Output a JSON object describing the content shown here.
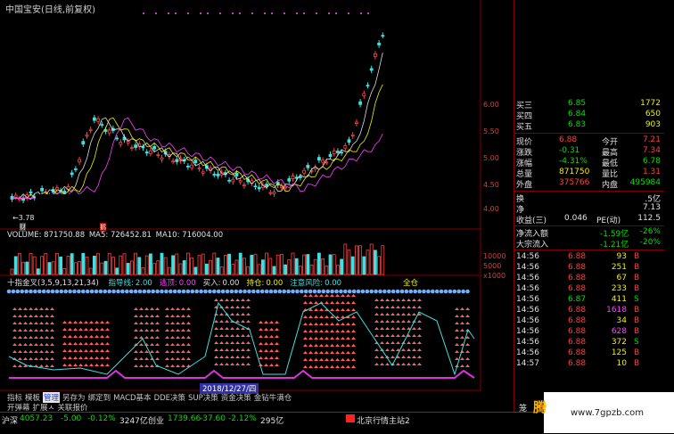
{
  "title": "中国宝安(日线,前复权)",
  "y_labels": [
    "6.00",
    "5.50",
    "5.00",
    "4.50",
    "4.00",
    "10000",
    "5000",
    "x1000"
  ],
  "min_label": "3.78",
  "cai_label": "财",
  "hui_label": "鹅",
  "volume": {
    "label": "VOLUME: 871750.88",
    "ma5": "MA5: 726452.81",
    "ma10": "MA10: 716004.00"
  },
  "indicator": {
    "name": "十指金叉(3,5,9,13,21,34)",
    "items": [
      {
        "label": "指导线:",
        "value": "2.00",
        "color": "#40e0e0"
      },
      {
        "label": "逃顶:",
        "value": "0.00",
        "color": "#ff40ff"
      },
      {
        "label": "买入:",
        "value": "0.00",
        "color": "#e0e0e0"
      },
      {
        "label": "持仓:",
        "value": "0.00",
        "color": "#f0f000"
      },
      {
        "label": "注意风险:",
        "value": "0.00",
        "color": "#40e0e0"
      }
    ],
    "full_position": "全仓"
  },
  "date_tag": "2018/12/27/四",
  "tabs": [
    "指标",
    "模板",
    "管理",
    "另存为",
    "绑定到",
    "MACD基本",
    "DDE决策",
    "SUP决策",
    "资金决策",
    "金钻牛满仓"
  ],
  "active_tab": "管理",
  "tabs2": [
    "开弹幕",
    "扩展ㅅ",
    "关联报价"
  ],
  "quote": {
    "asks": [
      {
        "label": "买三",
        "price": "6.85",
        "vol": "1772"
      },
      {
        "label": "买四",
        "price": "6.84",
        "vol": "650"
      },
      {
        "label": "买五",
        "price": "6.83",
        "vol": "903"
      }
    ],
    "stats": [
      {
        "l1": "现价",
        "v1": "6.88",
        "l2": "今开",
        "v2": "7.21",
        "c1": "#ff4040",
        "c2": "#ff4040"
      },
      {
        "l1": "涨跌",
        "v1": "-0.31",
        "l2": "最高",
        "v2": "7.34",
        "c1": "#00e000",
        "c2": "#ff4040"
      },
      {
        "l1": "涨幅",
        "v1": "-4.31%",
        "l2": "最低",
        "v2": "6.78",
        "c1": "#00e000",
        "c2": "#00e000"
      },
      {
        "l1": "总量",
        "v1": "871750",
        "l2": "量比",
        "v2": "1.31",
        "c1": "#f0f000",
        "c2": "#ff4040"
      },
      {
        "l1": "外盘",
        "v1": "375766",
        "l2": "内盘",
        "v2": "495984",
        "c1": "#ff4040",
        "c2": "#00e000"
      }
    ],
    "huanshou_label": "换",
    "huanshou_value": ".5亿",
    "jingzichan_label": "净",
    "jingzichan_value": "7.13",
    "shouyi_label": "收益(三)",
    "shouyi_value": "0.046",
    "pe_label": "PE(动)",
    "pe_value": "112.5",
    "flows": [
      {
        "label": "净流入额",
        "value": "-1.59亿",
        "pct": "-26%"
      },
      {
        "label": "大宗流入",
        "value": "-1.21亿",
        "pct": "-20%"
      }
    ],
    "ticks": [
      {
        "time": "14:56",
        "price": "6.88",
        "vol": "93",
        "side": "B"
      },
      {
        "time": "14:56",
        "price": "6.88",
        "vol": "251",
        "side": "B"
      },
      {
        "time": "14:56",
        "price": "6.88",
        "vol": "67",
        "side": "B"
      },
      {
        "time": "14:56",
        "price": "6.88",
        "vol": "233",
        "side": "B"
      },
      {
        "time": "14:56",
        "price": "6.87",
        "vol": "411",
        "side": "S"
      },
      {
        "time": "14:56",
        "price": "6.88",
        "vol": "1618",
        "side": "B"
      },
      {
        "time": "14:56",
        "price": "6.88",
        "vol": "34",
        "side": "B"
      },
      {
        "time": "14:56",
        "price": "6.88",
        "vol": "628",
        "side": "B"
      },
      {
        "time": "14:56",
        "price": "6.88",
        "vol": "372",
        "side": "S"
      },
      {
        "time": "14:56",
        "price": "6.88",
        "vol": "125",
        "side": "B"
      },
      {
        "time": "14:57",
        "price": "6.88",
        "vol": "10",
        "side": "B"
      }
    ]
  },
  "status": {
    "sh_label": "沪深",
    "sh_value": "4057.23",
    "sh_chg": "-5.00",
    "sh_pct": "-0.12%",
    "sh_amt": "3247亿",
    "cy_label": "创业",
    "cy_value": "1739.66",
    "cy_chg": "-37.60",
    "cy_pct": "-2.12%",
    "cy_amt": "295亿",
    "server": "北京行情主站2",
    "corner": "笼"
  },
  "watermark": {
    "logo": "腾",
    "url": "www.7gpzb.com"
  },
  "colors": {
    "up": "#ff4040",
    "down": "#00e000",
    "candle_up": "#ff4040",
    "candle_down": "#40e0e0",
    "volume_up": "#ff4040",
    "volume_down": "#40e0e0",
    "guide_line": "#40e0e0",
    "buy_bars": "#ff6060",
    "dots": "#70b0ff"
  }
}
